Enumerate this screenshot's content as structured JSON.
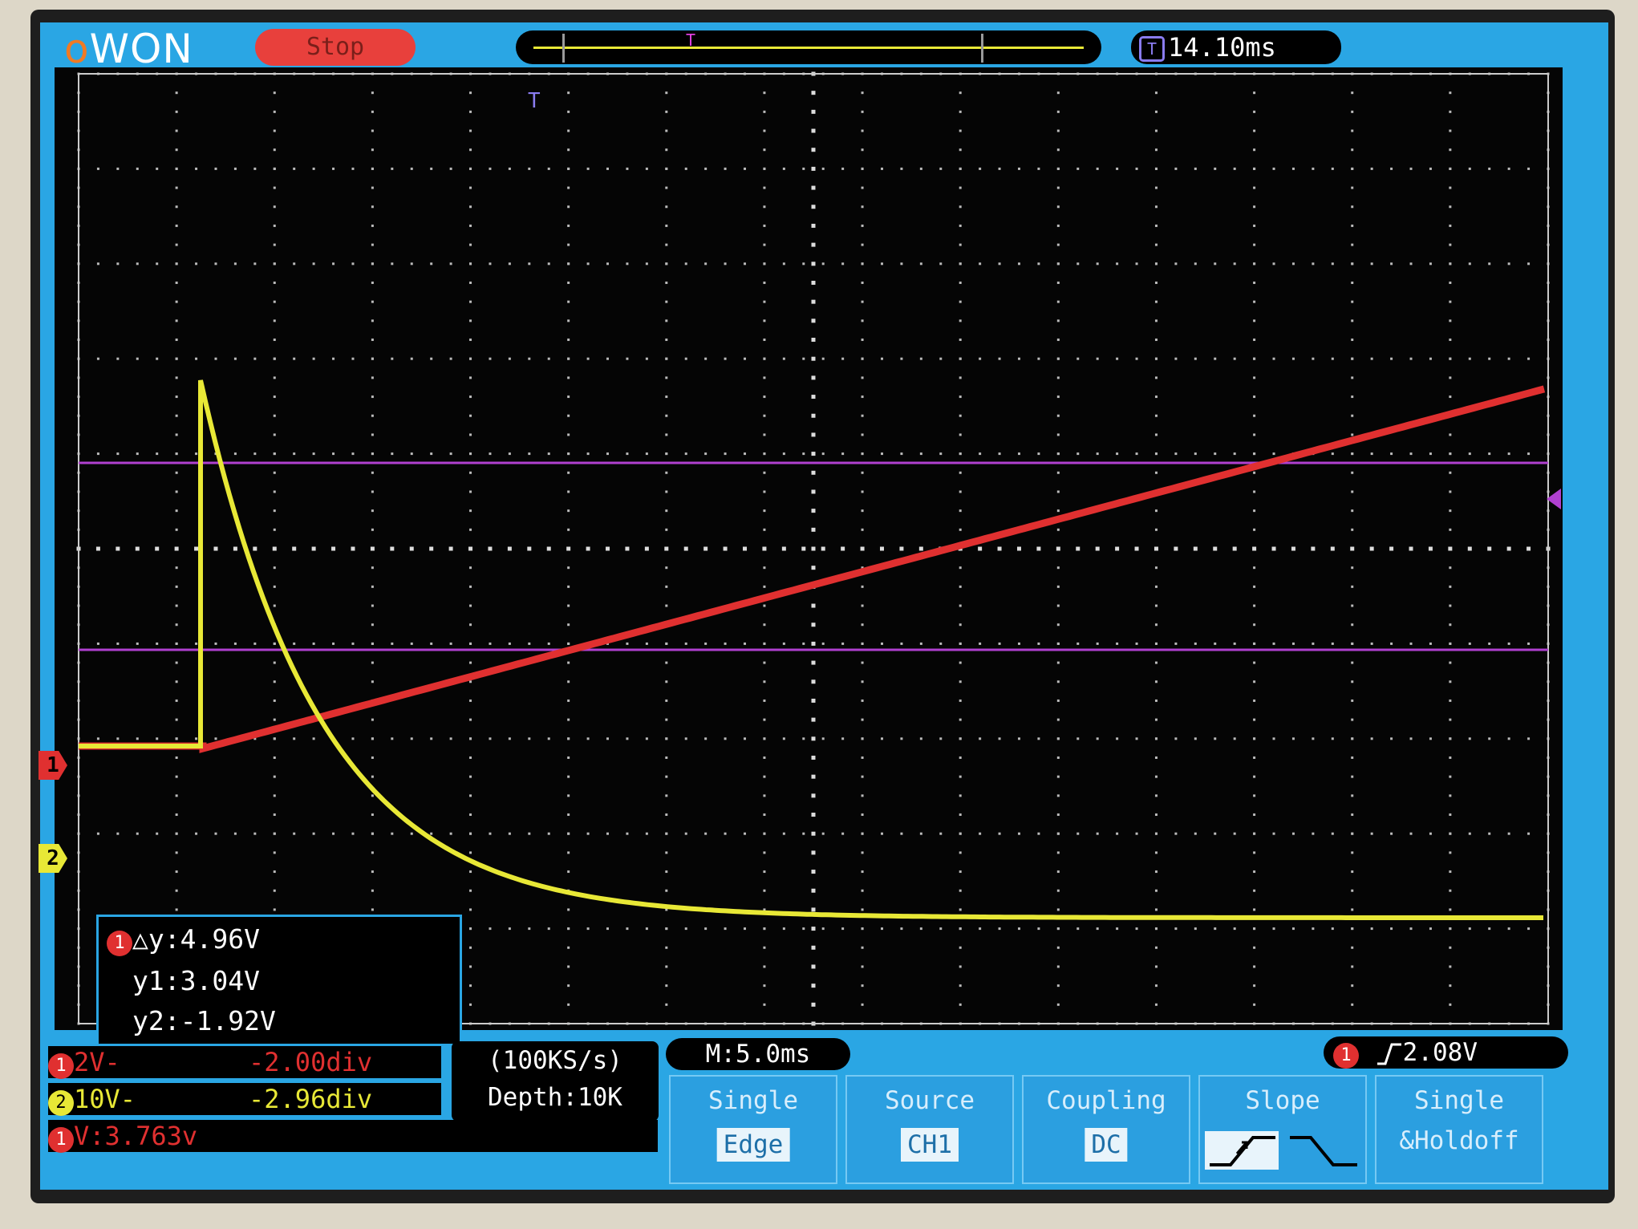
{
  "brand": {
    "logo_first": "o",
    "logo_rest": "WON"
  },
  "status": {
    "run_state": "Stop"
  },
  "trigger_time": {
    "icon": "T",
    "value": "14.10ms"
  },
  "memory_band": {
    "marker": "T"
  },
  "plot": {
    "trigger_marker": "T"
  },
  "cursor_readout": {
    "channel": "1",
    "delta_y": "△y:4.96V",
    "y1": "y1:3.04V",
    "y2": "y2:-1.92V"
  },
  "channels": [
    {
      "id": "1",
      "scale": "2V-",
      "offset": "-2.00div",
      "color": "#e03030"
    },
    {
      "id": "2",
      "scale": "10V-",
      "offset": "-2.96div",
      "color": "#e8e836"
    }
  ],
  "measurement": {
    "channel": "1",
    "text": "V:3.763v"
  },
  "acquisition": {
    "sample_rate": "(100KS/s)",
    "depth": "Depth:10K"
  },
  "timebase": {
    "text": "M:5.0ms"
  },
  "trigger": {
    "channel": "1",
    "level": "2.08V"
  },
  "menu": [
    {
      "title": "Single",
      "value": "Edge"
    },
    {
      "title": "Source",
      "value": "CH1"
    },
    {
      "title": "Coupling",
      "value": "DC"
    },
    {
      "title": "Slope",
      "value": ""
    },
    {
      "title": "Single",
      "value": "&Holdoff"
    }
  ],
  "colors": {
    "ch1": "#e03030",
    "ch2": "#e8e836",
    "cursor": "#b040d0",
    "screen": "#2aa6e4"
  }
}
